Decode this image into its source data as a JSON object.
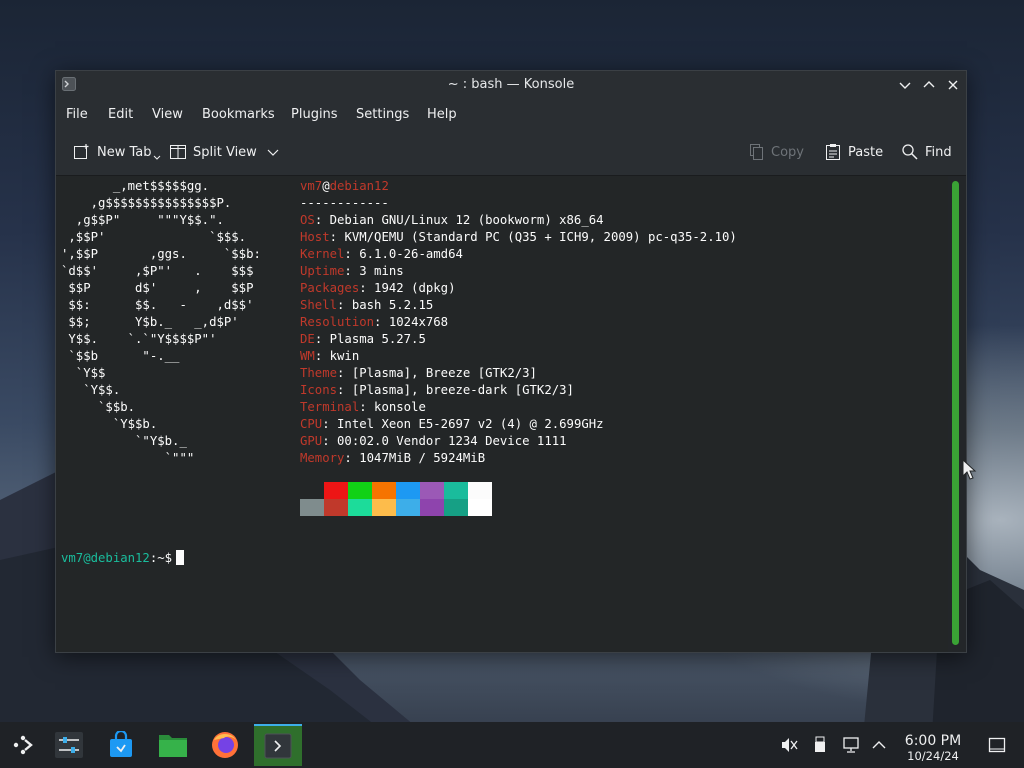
{
  "window": {
    "title": "~ : bash — Konsole"
  },
  "menu": {
    "file": "File",
    "edit": "Edit",
    "view": "View",
    "bookmarks": "Bookmarks",
    "plugins": "Plugins",
    "settings": "Settings",
    "help": "Help"
  },
  "toolbar": {
    "new_tab": "New Tab",
    "split_view": "Split View",
    "copy": "Copy",
    "paste": "Paste",
    "find": "Find"
  },
  "terminal": {
    "logo_lines": [
      "       _,met$$$$$gg.",
      "    ,g$$$$$$$$$$$$$$$P.",
      "  ,g$$P\"     \"\"\"Y$$.\".",
      " ,$$P'              `$$$.",
      "',$$P       ,ggs.     `$$b:",
      "`d$$'     ,$P\"'   .    $$$",
      " $$P      d$'     ,    $$P",
      " $$:      $$.   -    ,d$$'",
      " $$;      Y$b._   _,d$P'",
      " Y$$.    `.`\"Y$$$$P\"'",
      " `$$b      \"-.__",
      "  `Y$$",
      "   `Y$$.",
      "     `$$b.",
      "       `Y$$b.",
      "          `\"Y$b._",
      "              `\"\"\""
    ],
    "user": "vm7",
    "at": "@",
    "host": "debian12",
    "separator": "------------",
    "info": [
      {
        "key": "OS",
        "value": "Debian GNU/Linux 12 (bookworm) x86_64"
      },
      {
        "key": "Host",
        "value": "KVM/QEMU (Standard PC (Q35 + ICH9, 2009) pc-q35-2.10)"
      },
      {
        "key": "Kernel",
        "value": "6.1.0-26-amd64"
      },
      {
        "key": "Uptime",
        "value": "3 mins"
      },
      {
        "key": "Packages",
        "value": "1942 (dpkg)"
      },
      {
        "key": "Shell",
        "value": "bash 5.2.15"
      },
      {
        "key": "Resolution",
        "value": "1024x768"
      },
      {
        "key": "DE",
        "value": "Plasma 5.27.5"
      },
      {
        "key": "WM",
        "value": "kwin"
      },
      {
        "key": "Theme",
        "value": "[Plasma], Breeze [GTK2/3]"
      },
      {
        "key": "Icons",
        "value": "[Plasma], breeze-dark [GTK2/3]"
      },
      {
        "key": "Terminal",
        "value": "konsole"
      },
      {
        "key": "CPU",
        "value": "Intel Xeon E5-2697 v2 (4) @ 2.699GHz"
      },
      {
        "key": "GPU",
        "value": "00:02.0 Vendor 1234 Device 1111"
      },
      {
        "key": "Memory",
        "value": "1047MiB / 5924MiB"
      }
    ],
    "palette_top": [
      "#232627",
      "#ed1515",
      "#11d116",
      "#f67400",
      "#1d99f3",
      "#9b59b6",
      "#1abc9c",
      "#fcfcfc"
    ],
    "palette_bottom": [
      "#7f8c8d",
      "#c0392b",
      "#1cdc9a",
      "#fdbc4b",
      "#3daee9",
      "#8e44ad",
      "#16a085",
      "#ffffff"
    ],
    "prompt_user": "vm7@debian12",
    "prompt_suffix": ":~$"
  },
  "taskbar": {
    "apps": [
      {
        "name": "application-launcher-icon"
      },
      {
        "name": "system-settings-icon"
      },
      {
        "name": "discover-store-icon"
      },
      {
        "name": "dolphin-files-icon"
      },
      {
        "name": "firefox-icon"
      },
      {
        "name": "konsole-icon"
      }
    ],
    "clock_time": "6:00 PM",
    "clock_date": "10/24/24"
  },
  "colors": {
    "accent": "#3daee9",
    "scrollbar": "#3aa235",
    "info_key": "#c0392b",
    "prompt_user": "#1abc9c"
  }
}
